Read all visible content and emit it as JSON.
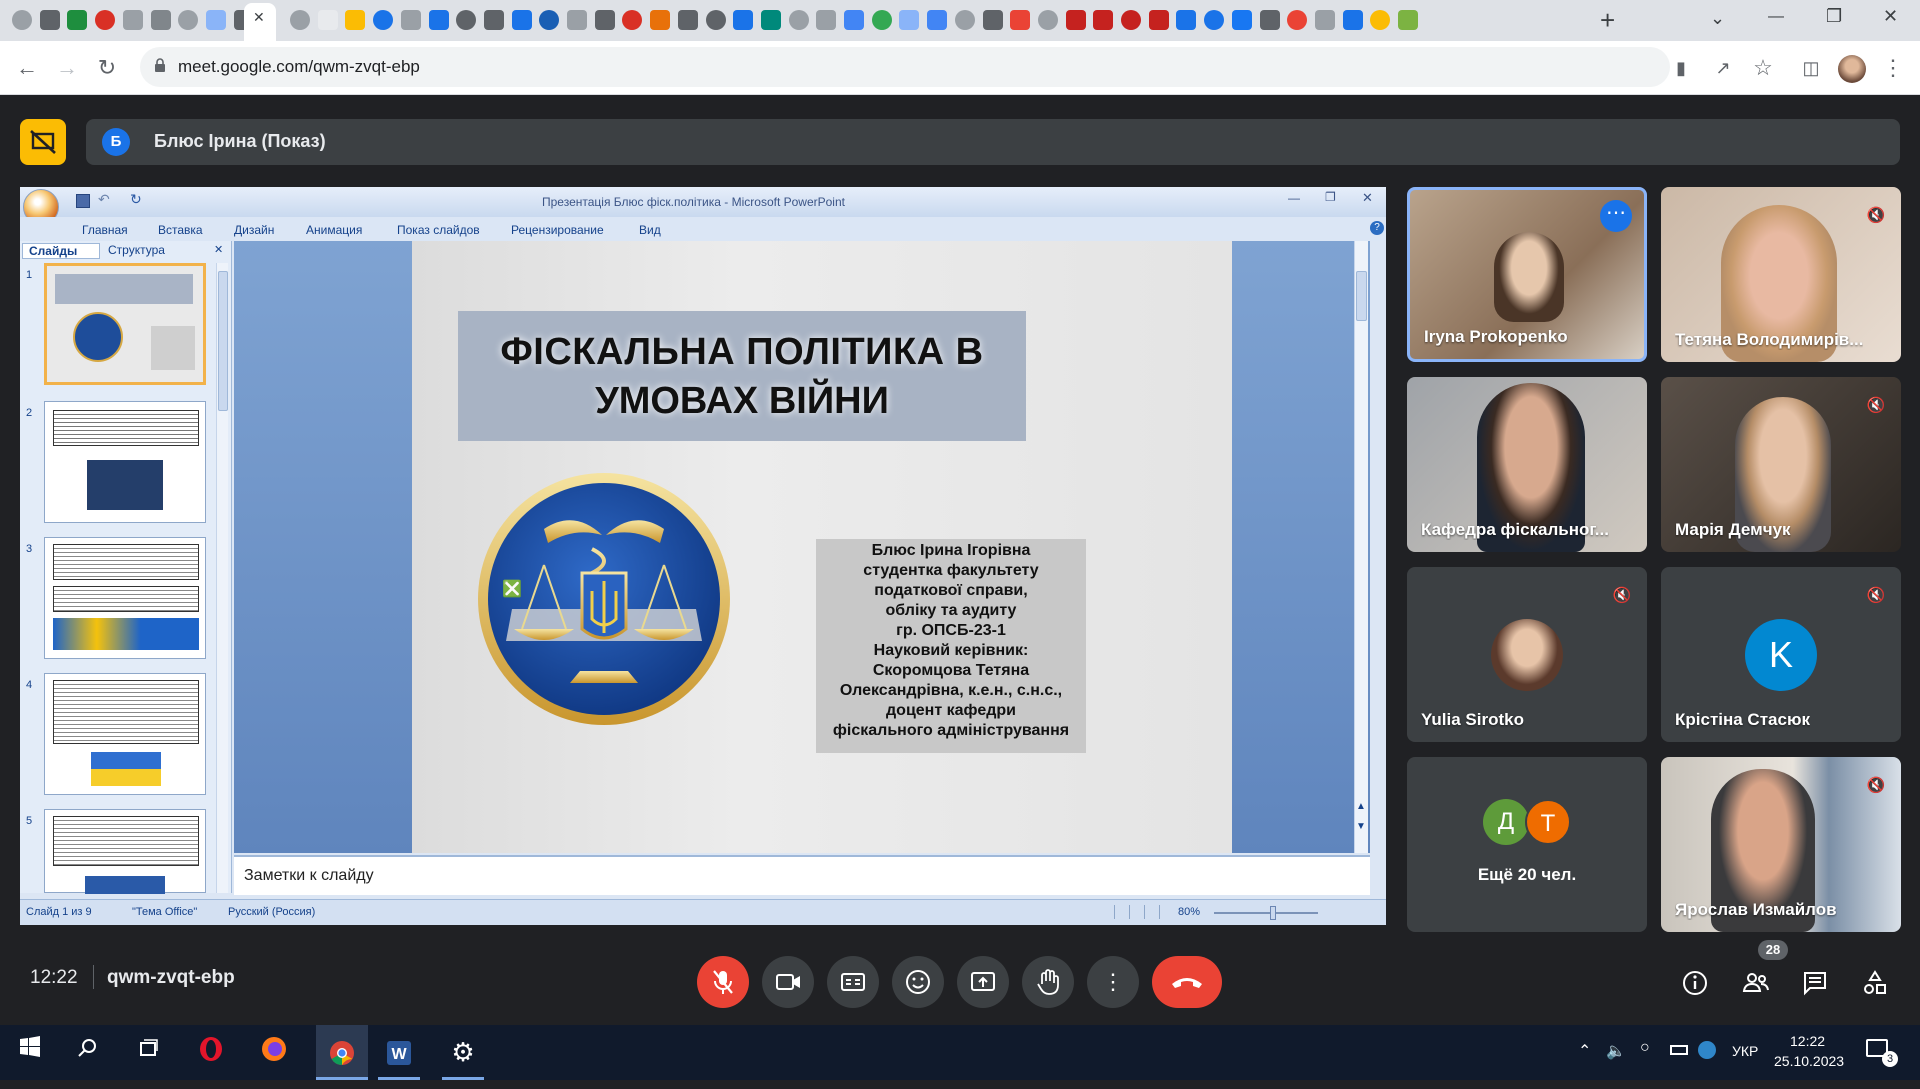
{
  "browser": {
    "url": "meet.google.com/qwm-zvqt-ebp",
    "new_tab_symbol": "+",
    "window_controls": [
      "⌄",
      "—",
      "❐",
      "✕"
    ],
    "tab_close": "✕"
  },
  "meet": {
    "presenter_avatar_letter": "Б",
    "presenter_label": "Блюс Ірина (Показ)",
    "time": "12:22",
    "meeting_code": "qwm-zvqt-ebp",
    "participants_count": "28",
    "colors": {
      "end_call": "#ea4335",
      "mic_off": "#ea4335",
      "accent": "#1a73e8"
    }
  },
  "ppt": {
    "window_title": "Презентація Блюс фіск.політика - Microsoft PowerPoint",
    "ribbon_tabs": [
      "Главная",
      "Вставка",
      "Дизайн",
      "Анимация",
      "Показ слайдов",
      "Рецензирование",
      "Вид"
    ],
    "panel_tabs": [
      "Слайды",
      "Структура"
    ],
    "thumb_numbers": [
      "1",
      "2",
      "3",
      "4",
      "5"
    ],
    "slide_title_line1": "ФІСКАЛЬНА ПОЛІТИКА В",
    "slide_title_line2": "УМОВАХ ВІЙНИ",
    "info_lines": [
      "Блюс Ірина Ігорівна",
      "студентка факультету",
      "податкової справи,",
      "обліку та аудиту",
      "гр. ОПСБ-23-1",
      "Науковий керівник:",
      "Скоромцова Тетяна",
      "Олександрівна, к.е.н., с.н.с.,",
      "доцент кафедри",
      "фіскального адміністрування"
    ],
    "notes_placeholder": "Заметки к слайду",
    "status_slide": "Слайд 1 из 9",
    "status_theme": "\"Тема Office\"",
    "status_lang": "Русский (Россия)",
    "zoom": "80%"
  },
  "tiles": [
    {
      "name": "Iryna Prokopenko",
      "muted": false,
      "kind": "video"
    },
    {
      "name": "Тетяна Володимирів...",
      "muted": true,
      "kind": "video"
    },
    {
      "name": "Кафедра фіскальног...",
      "muted": false,
      "kind": "video"
    },
    {
      "name": "Марія Демчук",
      "muted": true,
      "kind": "video"
    },
    {
      "name": "Yulia Sirotko",
      "muted": true,
      "kind": "photo"
    },
    {
      "name": "Крістіна Стасюк",
      "muted": true,
      "kind": "letter",
      "letter": "K"
    },
    {
      "name": "Ещё 20 чел.",
      "letters": [
        "Д",
        "Т"
      ],
      "kind": "more"
    },
    {
      "name": "Ярослав Измайлов",
      "muted": true,
      "kind": "video"
    }
  ],
  "taskbar": {
    "time": "12:22",
    "date": "25.10.2023",
    "lang": "УКР",
    "notifications": "3"
  }
}
